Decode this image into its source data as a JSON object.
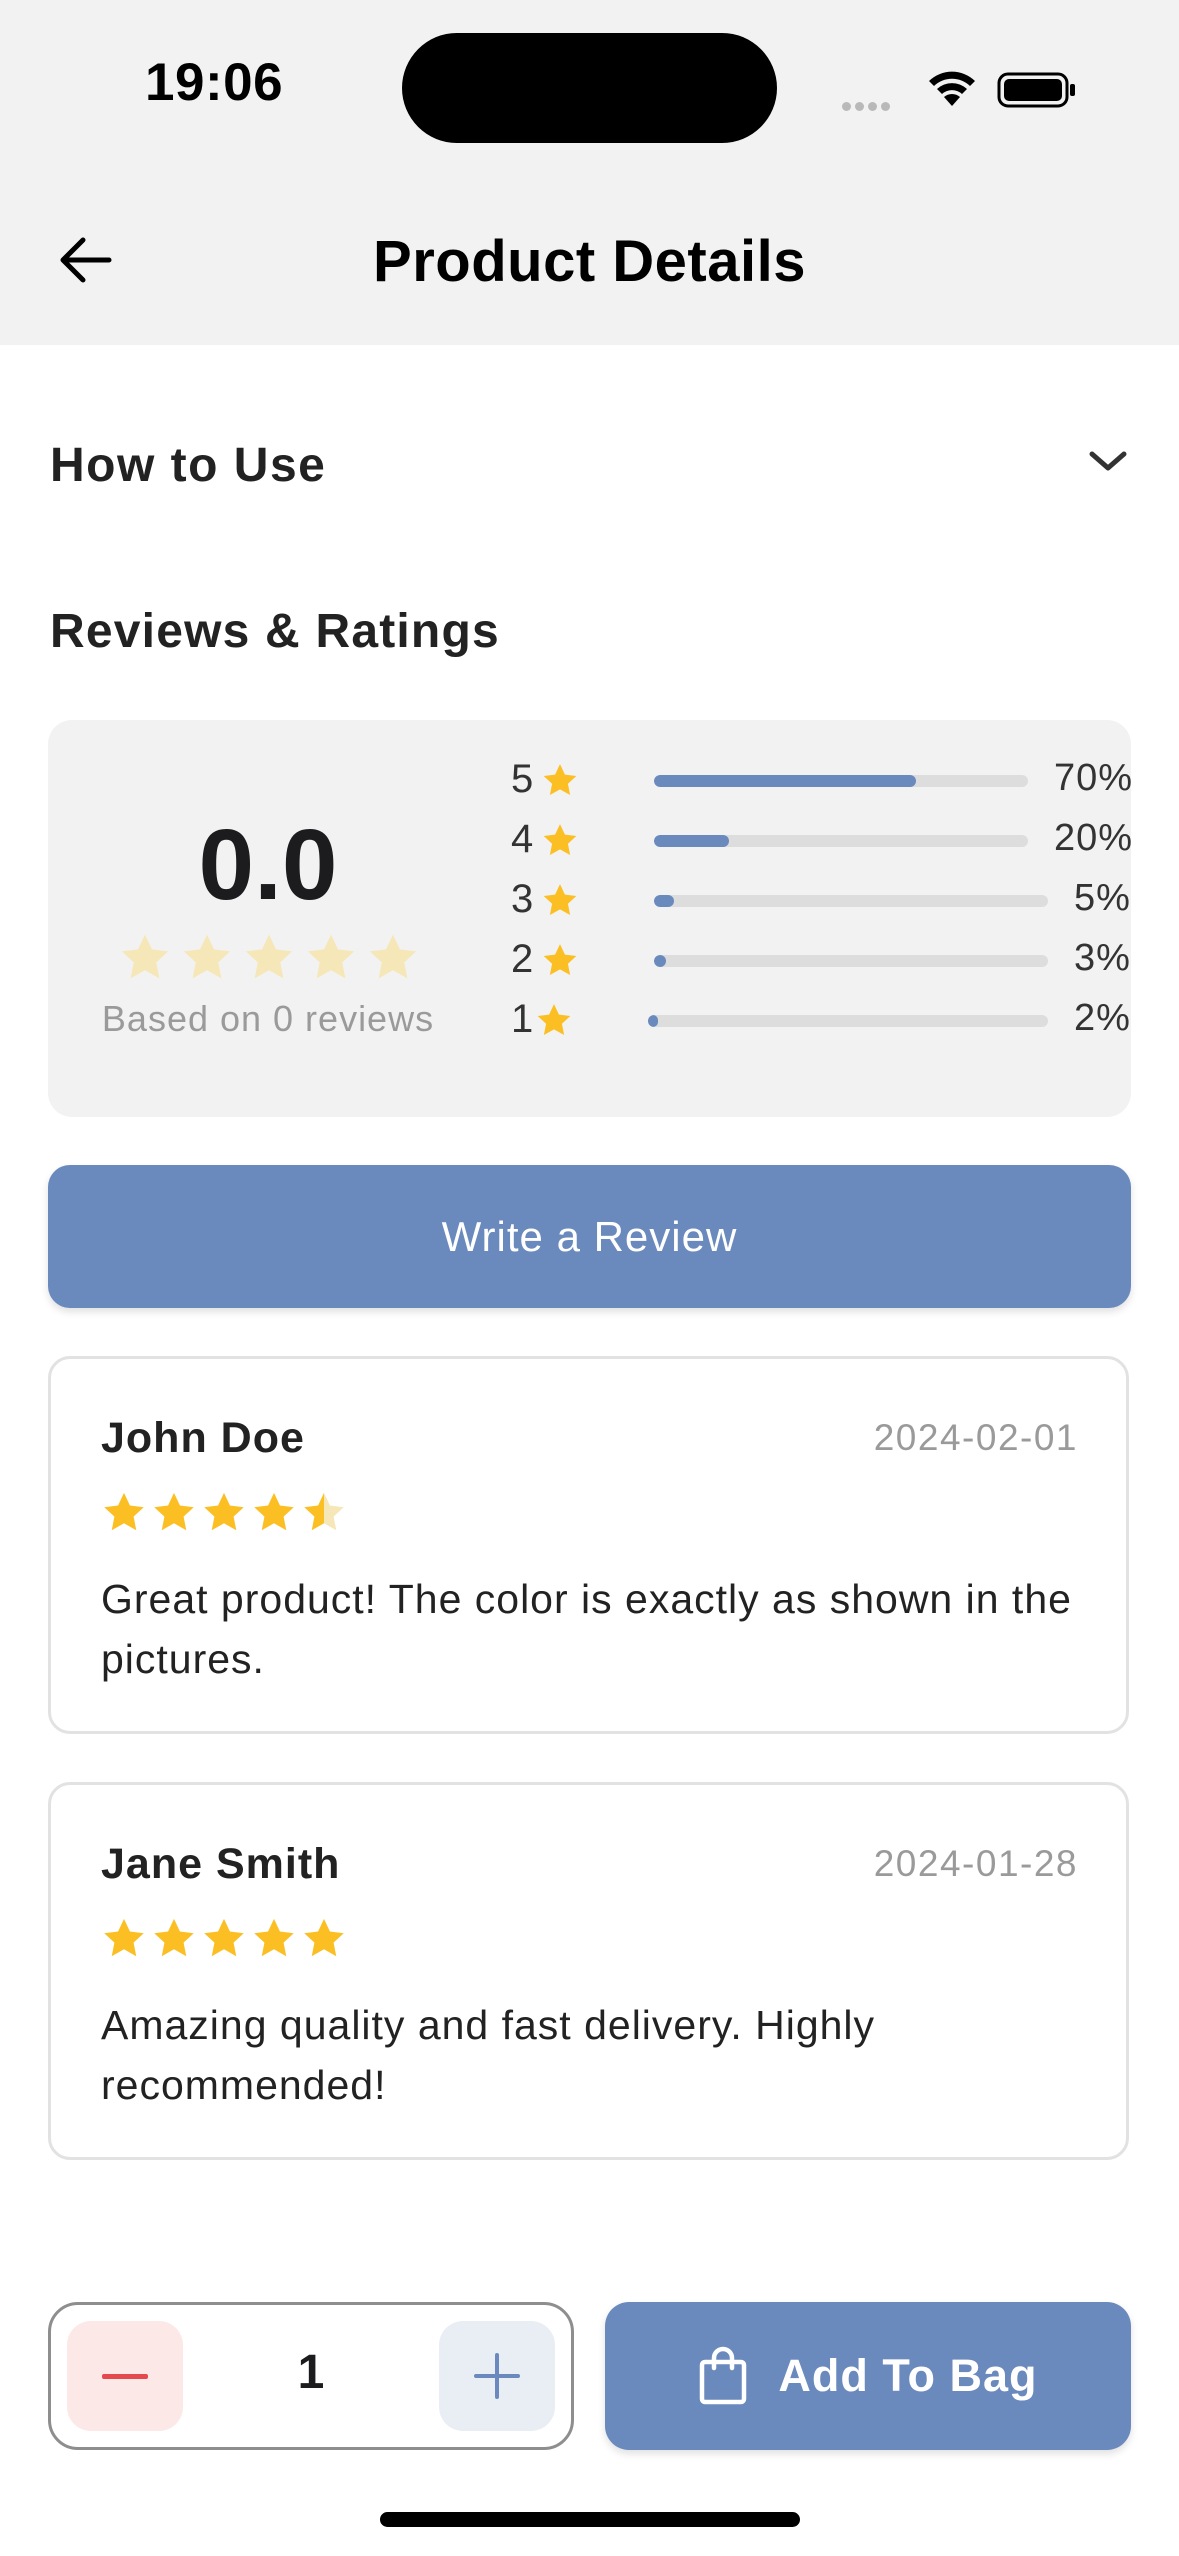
{
  "status_bar": {
    "time": "19:06"
  },
  "header": {
    "title": "Product Details",
    "back_icon": "arrow-left-icon"
  },
  "how_to_use": {
    "label": "How to Use",
    "icon": "chevron-down-icon"
  },
  "reviews": {
    "section_title": "Reviews & Ratings",
    "average": "0.0",
    "average_stars": 0,
    "based_on": "Based on 0 reviews",
    "distribution": [
      {
        "star": "5",
        "percent_label": "70%",
        "fraction": 0.7
      },
      {
        "star": "4",
        "percent_label": "20%",
        "fraction": 0.2
      },
      {
        "star": "3",
        "percent_label": "5%",
        "fraction": 0.05
      },
      {
        "star": "2",
        "percent_label": "3%",
        "fraction": 0.03
      },
      {
        "star": "1",
        "percent_label": "2%",
        "fraction": 0.02
      }
    ],
    "write_review_label": "Write a Review",
    "items": [
      {
        "name": "John Doe",
        "date": "2024-02-01",
        "rating": 4.5,
        "text": "Great product! The color is exactly as shown in the pictures."
      },
      {
        "name": "Jane Smith",
        "date": "2024-01-28",
        "rating": 5,
        "text": "Amazing quality and fast delivery. Highly recommended!"
      }
    ]
  },
  "bottom_bar": {
    "quantity": "1",
    "add_to_bag_label": "Add To Bag",
    "bag_icon": "shopping-bag-icon"
  },
  "colors": {
    "accent": "#6a89bd",
    "star": "#fbbf24",
    "star_faded": "#f6e7b8",
    "minus": "#e5484d"
  }
}
